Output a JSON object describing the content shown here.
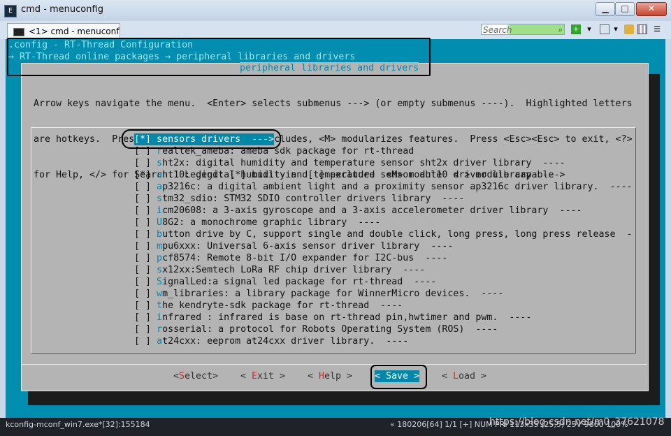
{
  "window": {
    "title": "cmd - menuconfig",
    "icon": "console-app-icon"
  },
  "window_controls": {
    "minimize": "▁",
    "maximize": "□",
    "close": "✕"
  },
  "tab": {
    "label": "<1> cmd - menuconf"
  },
  "search": {
    "placeholder": "Search"
  },
  "toolbar_icons": [
    "add-icon",
    "chevron-down-icon",
    "monitor-icon",
    "chevron-down-icon",
    "lock-icon",
    "grid-icon",
    "menu-icon"
  ],
  "menuconfig": {
    "config_title": ".config - RT-Thread Configuration",
    "breadcrumb": "→ RT-Thread online packages → peripheral libraries and drivers",
    "dialog_title": "peripheral libraries and drivers",
    "help_lines": [
      "Arrow keys navigate the menu.  <Enter> selects submenus ---> (or empty submenus ----).  Highlighted letters",
      "are hotkeys.  Pressing <Y> includes, <N> excludes, <M> modularizes features.  Press <Esc><Esc> to exit, <?>",
      "for Help, </> for Search.  Legend: [*] built-in  [ ] excluded  <M> module  < > module capable"
    ],
    "items": [
      {
        "box": "[*]",
        "hotkey": "s",
        "rest": "ensors drivers  --->",
        "selected": true
      },
      {
        "box": "[ ]",
        "hotkey": "r",
        "rest": "ealtek_ameba: ameba sdk package for rt-thread"
      },
      {
        "box": "[ ]",
        "hotkey": "s",
        "rest": "ht2x: digital humidity and temperature sensor sht2x driver library  ----"
      },
      {
        "box": "[*]",
        "hotkey": "a",
        "rest": "ht10: digital humidity and temperature sensor aht10 driver library  --->"
      },
      {
        "box": "[ ]",
        "hotkey": "a",
        "rest": "p3216c: a digital ambient light and a proximity sensor ap3216c driver library.  ----"
      },
      {
        "box": "[ ]",
        "hotkey": "s",
        "rest": "tm32_sdio: STM32 SDIO controller drivers library  ----"
      },
      {
        "box": "[ ]",
        "hotkey": "i",
        "rest": "cm20608: a 3-axis gyroscope and a 3-axis accelerometer driver library  ----"
      },
      {
        "box": "[ ]",
        "hotkey": "U",
        "rest": "8G2: a monochrome graphic library  ----"
      },
      {
        "box": "[ ]",
        "hotkey": "b",
        "rest": "utton drive by C, support single and double click, long press, long press release  -"
      },
      {
        "box": "[ ]",
        "hotkey": "m",
        "rest": "pu6xxx: Universal 6-axis sensor driver library  ----"
      },
      {
        "box": "[ ]",
        "hotkey": "p",
        "rest": "cf8574: Remote 8-bit I/O expander for I2C-bus  ----"
      },
      {
        "box": "[ ]",
        "hotkey": "s",
        "rest": "x12xx:Semtech LoRa RF chip driver library  ----"
      },
      {
        "box": "[ ]",
        "hotkey": "S",
        "rest": "ignalLed:a signal led package for rt-thread  ----"
      },
      {
        "box": "[ ]",
        "hotkey": "w",
        "rest": "m_libraries: a library package for WinnerMicro devices.  ----"
      },
      {
        "box": "[ ]",
        "hotkey": "t",
        "rest": "he kendryte-sdk package for rt-thread  ----"
      },
      {
        "box": "[ ]",
        "hotkey": "i",
        "rest": "nfrared : infrared is base on rt-thread pin,hwtimer and pwm.  ----"
      },
      {
        "box": "[ ]",
        "hotkey": "r",
        "rest": "osserial: a protocol for Robots Operating System (ROS)  ----"
      },
      {
        "box": "[ ]",
        "hotkey": "a",
        "rest": "t24cxx: eeprom at24cxx driver library.  ----"
      }
    ],
    "buttons": [
      {
        "pre": "<",
        "hk": "S",
        "post": "elect>"
      },
      {
        "pre": "< ",
        "hk": "E",
        "post": "xit >"
      },
      {
        "pre": "< ",
        "hk": "H",
        "post": "elp >"
      },
      {
        "pre": "< ",
        "hk": "S",
        "post": "ave >",
        "active": true
      },
      {
        "pre": "< ",
        "hk": "L",
        "post": "oad >"
      }
    ]
  },
  "statusbar": {
    "process": "kconfig-mconf_win7.exe*[32]:155184",
    "info": "« 180206[64]  1/1  [+] NUM  PRI  113x35  (25,5) 25V  9860  100%",
    "watermark": "https://blog.csdn.net/m0_37621078"
  },
  "colors": {
    "console_bg": "#008eb0",
    "dialog_bg": "#b4b4b4",
    "highlight": "#0088aa",
    "hotkey_button": "#c0302a"
  }
}
